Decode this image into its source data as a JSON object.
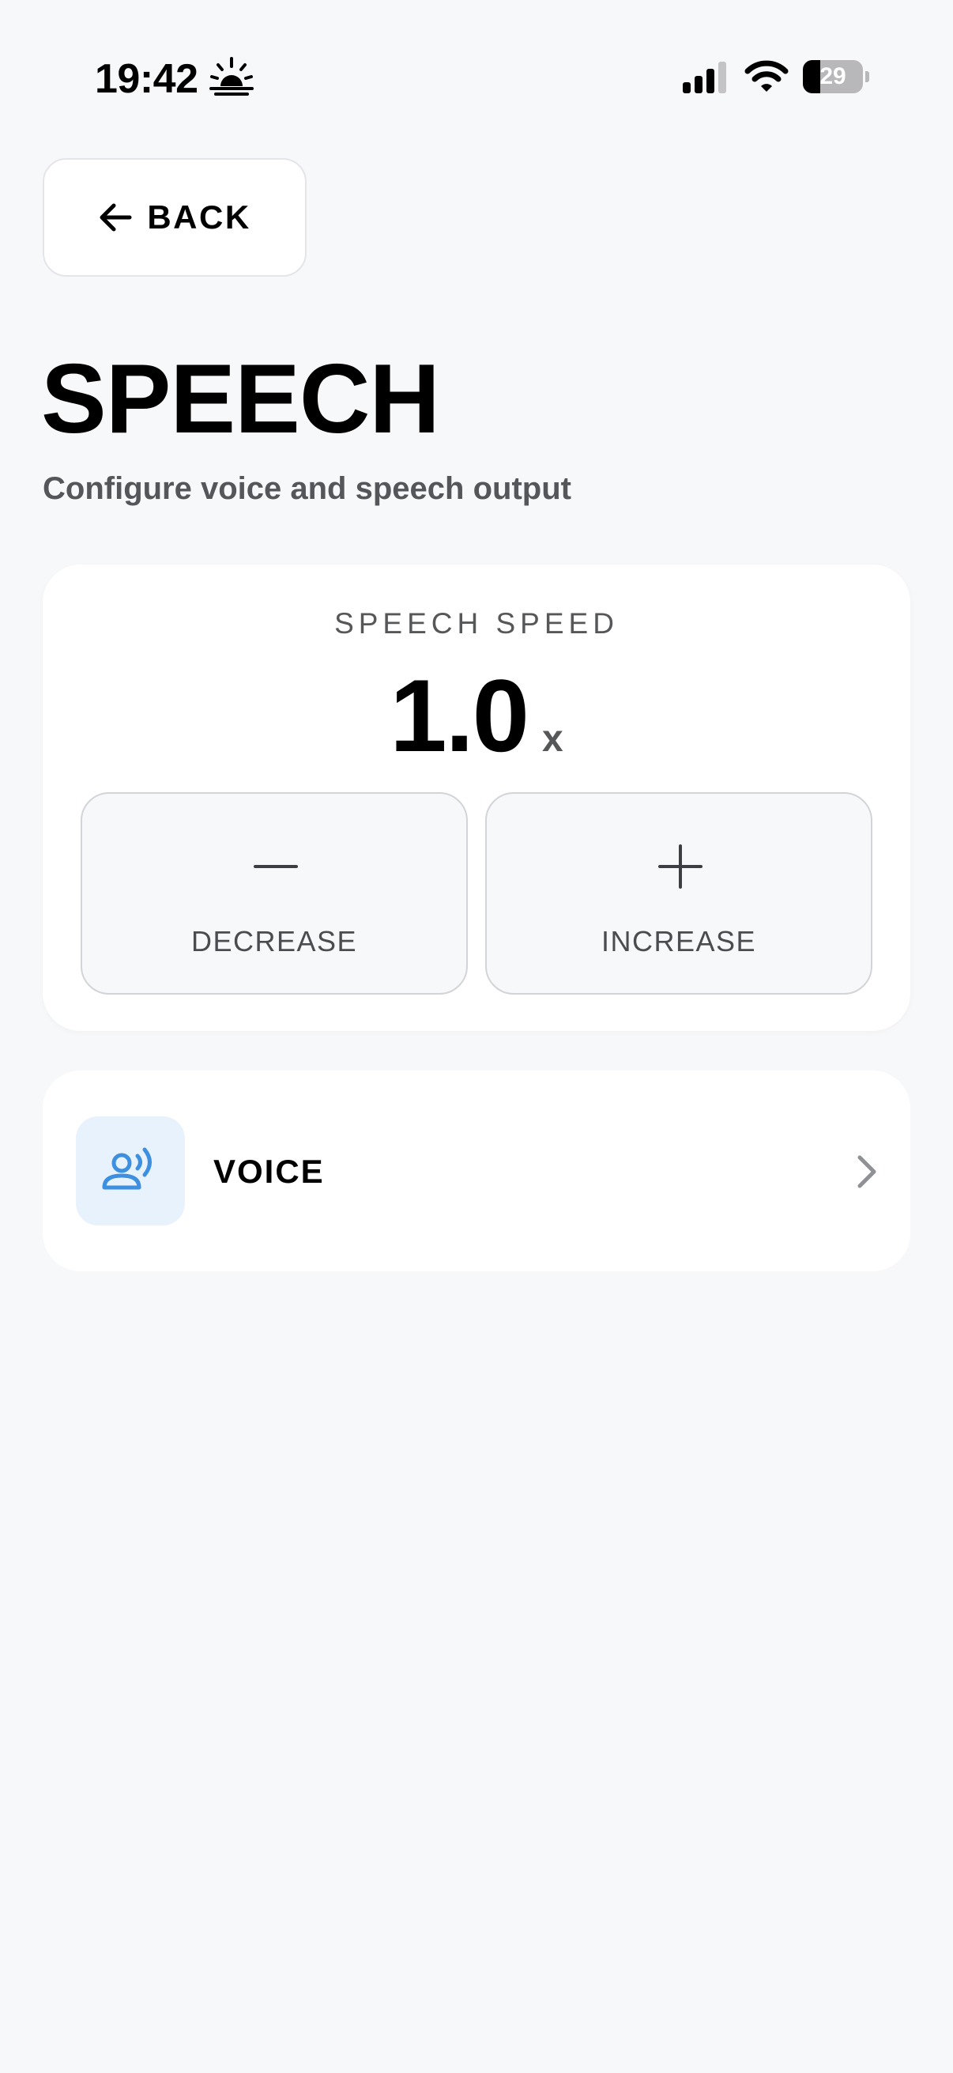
{
  "status_bar": {
    "time": "19:42",
    "battery_level": "29",
    "battery_fraction": 0.29,
    "icons": [
      "sunrise-icon",
      "cellular-signal-icon",
      "wifi-icon",
      "battery-icon"
    ]
  },
  "nav": {
    "back_label": "BACK",
    "back_icon": "arrow-left-icon"
  },
  "header": {
    "title": "SPEECH",
    "subtitle": "Configure voice and speech output"
  },
  "speed": {
    "label": "SPEECH SPEED",
    "value": "1.0",
    "unit": "x",
    "decrease_label": "DECREASE",
    "decrease_icon": "minus-icon",
    "increase_label": "INCREASE",
    "increase_icon": "plus-icon"
  },
  "voice": {
    "label": "VOICE",
    "icon": "speaking-person-icon",
    "chevron_icon": "chevron-right-icon"
  },
  "colors": {
    "background": "#f7f8fa",
    "card": "#ffffff",
    "accent_blue": "#3d8fe0",
    "icon_tile": "#e8f2fd",
    "muted_text": "#555759"
  }
}
